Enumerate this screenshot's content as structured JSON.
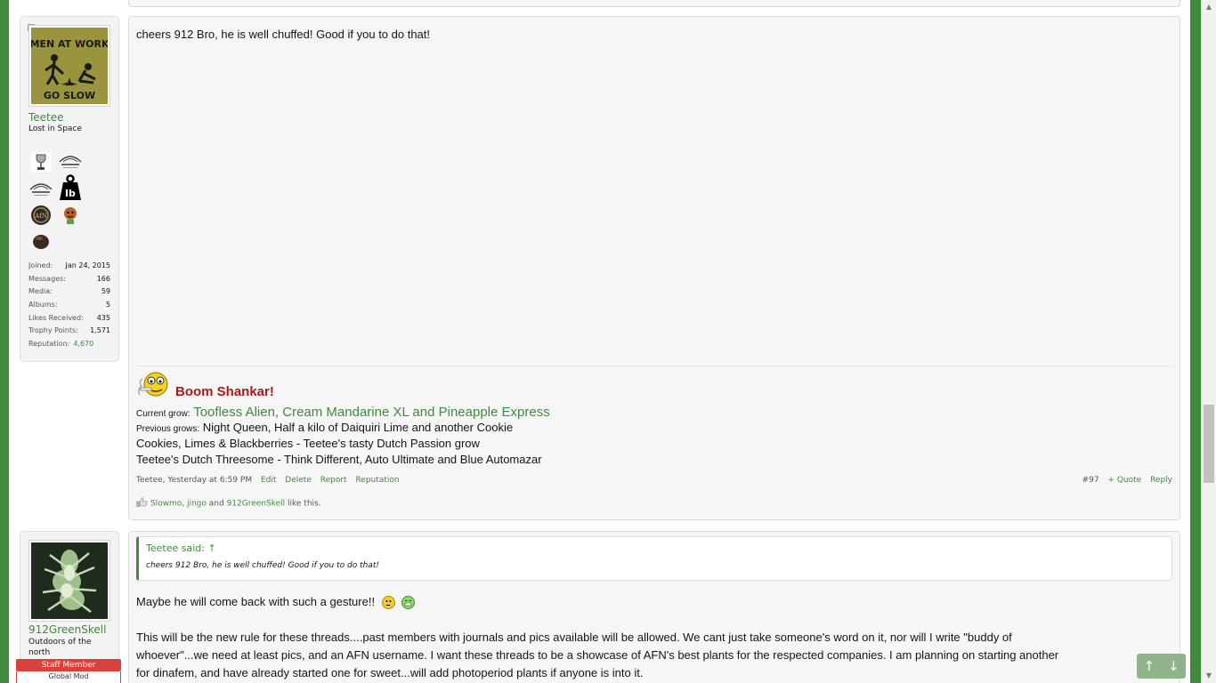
{
  "posts": [
    {
      "user": {
        "name": "Teetee",
        "title": "Lost in Space",
        "avatar_text_top": "MEN AT WORK",
        "avatar_text_bottom": "GO SLOW",
        "trophy_icons": [
          "trophy-cup-icon",
          "logo-emblem-icon",
          "logo-emblem-icon",
          "weight-lb-icon",
          "afn-badge-icon",
          "mascot-icon",
          "brown-ball-icon"
        ],
        "weight_text": "lb",
        "afn_text": "AfN",
        "stats": [
          {
            "label": "Joined:",
            "value": "Jan 24, 2015"
          },
          {
            "label": "Messages:",
            "value": "166"
          },
          {
            "label": "Media:",
            "value": "59"
          },
          {
            "label": "Albums:",
            "value": "5"
          },
          {
            "label": "Likes Received:",
            "value": "435"
          },
          {
            "label": "Trophy Points:",
            "value": "1,571"
          },
          {
            "label": "Reputation:",
            "value": "4,670"
          }
        ]
      },
      "message": "cheers 912 Bro, he is well chuffed! Good if you to do that!",
      "signature": {
        "title": "Boom Shankar!",
        "current_label": "Current grow:",
        "current_value": "Toofless Alien, Cream Mandarine XL and Pineapple Express",
        "previous_label": "Previous grows:",
        "previous_line1": "Night Queen, Half a kilo of Daiquiri Lime and another Cookie",
        "previous_line2": "Cookies, Limes & Blackberries - Teetee's tasty Dutch Passion grow",
        "previous_line3": "Teetee's Dutch Threesome - Think Different, Auto Ultimate and Blue Automazar"
      },
      "meta": {
        "author_time": "Teetee, Yesterday at 6:59 PM",
        "edit": "Edit",
        "delete": "Delete",
        "report": "Report",
        "reputation": "Reputation",
        "post_number": "#97",
        "quote": "+ Quote",
        "reply": "Reply"
      },
      "likes": {
        "user1": "Slowmo",
        "sep1": ", ",
        "user2": "jingo",
        "and": " and ",
        "user3": "912GreenSkell",
        "suffix": " like this."
      }
    },
    {
      "user": {
        "name": "912GreenSkell",
        "title_line1": "Outdoors of the",
        "title_line2": "north",
        "staff_banner": "Staff Member",
        "global_banner": "Global Mod"
      },
      "quote": {
        "author": "Teetee said: ↑",
        "text": "cheers 912 Bro, he is well chuffed! Good if you to do that!"
      },
      "message_line1": "Maybe he will come back with such a gesture!!",
      "paragraph_line1": "This will be the new rule for these threads....past members with journals and pics available will be allowed. We cant just take someone's word on it, nor will I write \"buddy of",
      "paragraph_line2": "whoever\"...we need at least pics, and an AFN username. I want these threads to be a showcase of AFN's best plants for the respected companies. I am planning on starting another",
      "paragraph_line3": "for dinafem, and have already started one for sweet...will add photoperiod plants if anyone is into it."
    }
  ],
  "scroll_buttons": {
    "up": "↑",
    "down": "↓"
  },
  "colors": {
    "accent": "#3f8a3c",
    "signature_title": "#a41c1c",
    "staff_banner": "#d9413e"
  }
}
